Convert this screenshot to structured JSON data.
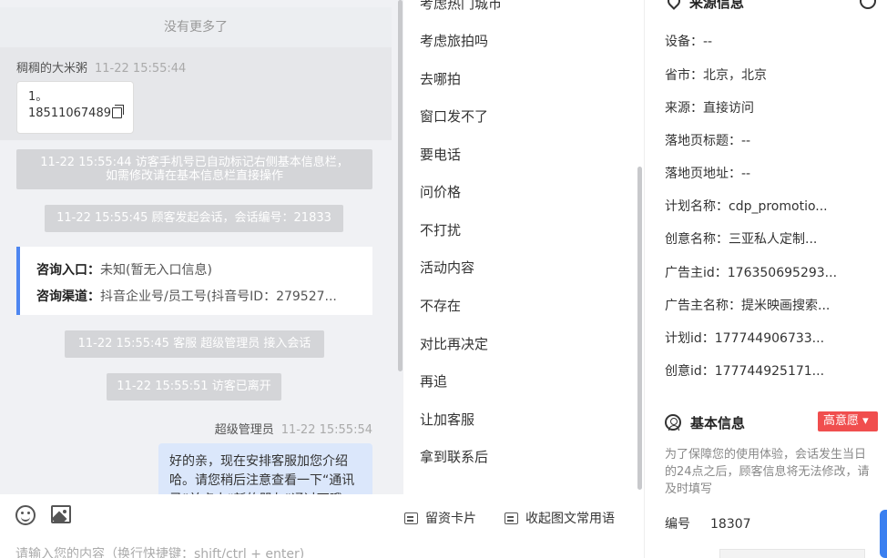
{
  "chat": {
    "no_more": "没有更多了",
    "visitor": {
      "name": "稠稠的大米粥",
      "time": "11-22 15:55:44",
      "line1": "1。",
      "line2": "18511067489"
    },
    "system_messages": [
      "11-22 15:55:44 访客手机号已自动标记右侧基本信息栏，",
      "如需修改请在基本信息栏直接操作",
      "11-22 15:55:45 顾客发起会话，会话编号：21833",
      "11-22 15:55:45 客服 超级管理员 接入会话",
      "11-22 15:55:51 访客已离开"
    ],
    "consult": {
      "entry_label": "咨询入口：",
      "entry_value": "未知(暂无入口信息)",
      "channel_label": "咨询渠道：",
      "channel_value": "抖音企业号/员工号(抖音号ID：279527..."
    },
    "agent": {
      "name": "超级管理员",
      "time": "11-22 15:55:54",
      "message": "好的亲，现在安排客服加您介绍哈。请您稍后注意查看一下“通讯录”并点击“新的朋友”通过下哦"
    },
    "input_placeholder": "请输入您的内容（换行快捷键：shift/ctrl + enter)"
  },
  "phrases": {
    "items": [
      "考虑热门城市",
      "考虑旅拍吗",
      "去哪拍",
      "窗口发不了",
      "要电话",
      "问价格",
      "不打扰",
      "活动内容",
      "不存在",
      "对比再决定",
      "再追",
      "让加客服",
      "拿到联系后"
    ],
    "bar": {
      "leave_card": "留资卡片",
      "collapse": "收起图文常用语"
    }
  },
  "info": {
    "source_title": "来源信息",
    "source_rows": [
      "设备：--",
      "省市：北京，北京",
      "来源：直接访问",
      "落地页标题：--",
      "落地页地址：--",
      "计划名称：cdp_promotio...",
      "创意名称：三亚私人定制...",
      "广告主id：176350695293...",
      "广告主名称：提米映画搜索...",
      "计划id：177744906733...",
      "创意id：177744925171..."
    ],
    "basic_title": "基本信息",
    "intent_badge": "高意愿 ▾",
    "note": "为了保障您的使用体验，会话发生当日的24点之后，顾客信息将无法修改，请及时填写",
    "id_label": "编号",
    "id_value": "18307"
  }
}
